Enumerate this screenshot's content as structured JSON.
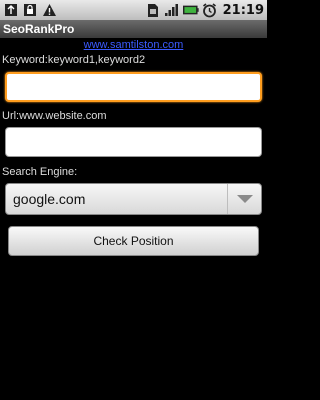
{
  "status_bar": {
    "time": "21:19",
    "left_icons": [
      "usb-icon",
      "lock-icon",
      "warning-icon"
    ],
    "right_icons": [
      "sim-icon",
      "signal-icon",
      "battery-icon",
      "alarm-icon"
    ]
  },
  "app": {
    "title": "SeoRankPro",
    "link_text": "www.samtilston.com"
  },
  "form": {
    "keyword_label": "Keyword:keyword1,keyword2",
    "keyword_value": "",
    "url_label": "Url:www.website.com",
    "url_value": "",
    "engine_label": "Search Engine:",
    "engine_selected": "google.com",
    "check_button": "Check Position"
  },
  "colors": {
    "focus_border": "#ff9d1e",
    "link": "#3b5bff"
  }
}
